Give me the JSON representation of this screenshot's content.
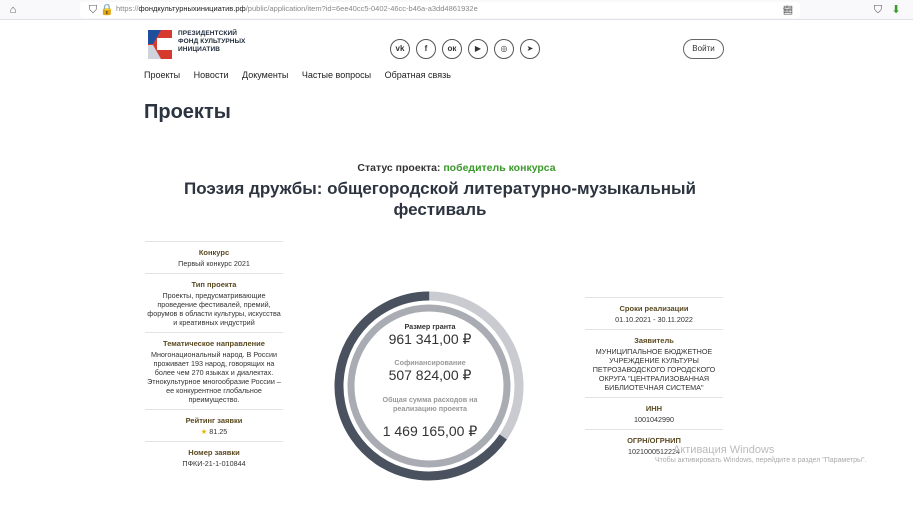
{
  "browser": {
    "url_prefix": "https://",
    "url_domain": "фондкультурныхинициатив.рф",
    "url_path": "/public/application/item?id=6ee40cc5-0402-46cc-b46a-a3dd4861932e"
  },
  "header": {
    "logo_lines": [
      "ПРЕЗИДЕНТСКИЙ",
      "ФОНД КУЛЬТУРНЫХ",
      "ИНИЦИАТИВ"
    ],
    "social": [
      "vk",
      "facebook",
      "odnoklassniki",
      "youtube",
      "instagram",
      "telegram"
    ],
    "login_label": "Войти"
  },
  "nav": {
    "items": [
      "Проекты",
      "Новости",
      "Документы",
      "Частые вопросы",
      "Обратная связь"
    ]
  },
  "page_title": "Проекты",
  "project": {
    "status_label": "Статус проекта:",
    "status_value": "победитель конкурса",
    "title": "Поэзия дружбы: общегородской литературно-музыкальный фестиваль"
  },
  "left_info": [
    {
      "label": "Конкурс",
      "value": "Первый конкурс 2021"
    },
    {
      "label": "Тип проекта",
      "value": "Проекты, предусматривающие проведение фестивалей, премий, форумов в области культуры, искусства и креативных индустрий"
    },
    {
      "label": "Тематическое направление",
      "value": "Многонациональный народ. В России проживает 193 народ, говорящих на более чем 270 языках и диалектах. Этнокультурное многообразие России – ее конкурентное глобальное преимущество."
    },
    {
      "label": "Рейтинг заявки",
      "value": "81.25"
    },
    {
      "label": "Номер заявки",
      "value": "ПФКИ-21-1-010844"
    }
  ],
  "right_info": [
    {
      "label": "Сроки реализации",
      "value": "01.10.2021 - 30.11.2022"
    },
    {
      "label": "Заявитель",
      "value": "МУНИЦИПАЛЬНОЕ БЮДЖЕТНОЕ УЧРЕЖДЕНИЕ КУЛЬТУРЫ ПЕТРОЗАВОДСКОГО ГОРОДСКОГО ОКРУГА \"ЦЕНТРАЛИЗОВАННАЯ БИБЛИОТЕЧНАЯ СИСТЕМА\""
    },
    {
      "label": "ИНН",
      "value": "1001042990"
    },
    {
      "label": "ОГРН/ОГРНИП",
      "value": "1021000512224"
    }
  ],
  "finance": {
    "grant_label": "Размер гранта",
    "grant_value": "961 341,00 ₽",
    "cofin_label": "Софинансирование",
    "cofin_value": "507 824,00 ₽",
    "total_label": "Общая сумма расходов на реализацию проекта",
    "total_value": "1 469 165,00 ₽",
    "grant_amount": 961341,
    "cofin_amount": 507824
  },
  "colors": {
    "donut_dark": "#4a5260",
    "donut_mid": "#c9cbd0",
    "donut_light": "#e6e7ea",
    "status_green": "#3a9a2a"
  },
  "watermark": {
    "title": "Активация Windows",
    "text": "Чтобы активировать Windows, перейдите в раздел \"Параметры\"."
  }
}
